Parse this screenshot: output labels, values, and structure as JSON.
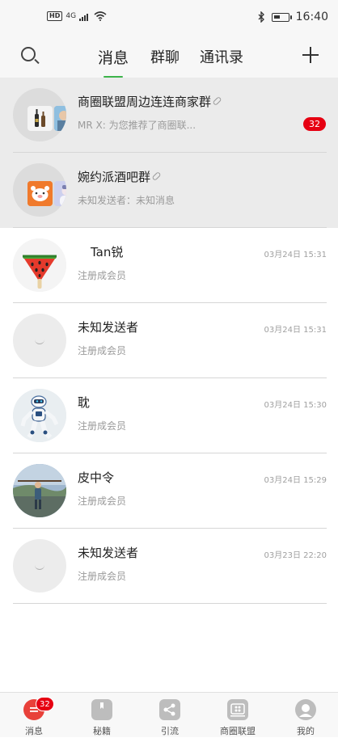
{
  "status_bar": {
    "network": "HD",
    "signal": "4G",
    "time": "16:40"
  },
  "header": {
    "tabs": [
      {
        "label": "消息",
        "active": true
      },
      {
        "label": "群聊",
        "active": false
      },
      {
        "label": "通讯录",
        "active": false
      }
    ],
    "accent_color": "#3cb34a"
  },
  "conversations": [
    {
      "title": "商圈联盟周边连连商家群",
      "subtitle": "MR  X:  为您推荐了商圈联...",
      "time": "",
      "badge": "32",
      "pinned": true,
      "is_group": true
    },
    {
      "title": "婉约派酒吧群",
      "subtitle": "未知发送者：未知消息",
      "time": "",
      "badge": "",
      "pinned": true,
      "is_group": true
    },
    {
      "title": "Tan锐",
      "subtitle": "注册成会员",
      "time": "03月24日 15:31",
      "badge": "",
      "pinned": false,
      "avatar": "watermelon-popsicle"
    },
    {
      "title": "未知发送者",
      "subtitle": "注册成会员",
      "time": "03月24日 15:31",
      "badge": "",
      "pinned": false,
      "avatar": "default"
    },
    {
      "title": "耽",
      "subtitle": "注册成会员",
      "time": "03月24日 15:30",
      "badge": "",
      "pinned": false,
      "avatar": "robot"
    },
    {
      "title": "皮中令",
      "subtitle": "注册成会员",
      "time": "03月24日 15:29",
      "badge": "",
      "pinned": false,
      "avatar": "person-photo"
    },
    {
      "title": "未知发送者",
      "subtitle": "注册成会员",
      "time": "03月23日 22:20",
      "badge": "",
      "pinned": false,
      "avatar": "default"
    }
  ],
  "tabbar": {
    "items": [
      {
        "label": "消息",
        "icon": "message-icon",
        "badge": "32"
      },
      {
        "label": "秘籍",
        "icon": "book-icon"
      },
      {
        "label": "引流",
        "icon": "share-icon"
      },
      {
        "label": "商圈联盟",
        "icon": "alliance-icon"
      },
      {
        "label": "我的",
        "icon": "profile-icon"
      }
    ],
    "badge_color": "#e60012"
  }
}
